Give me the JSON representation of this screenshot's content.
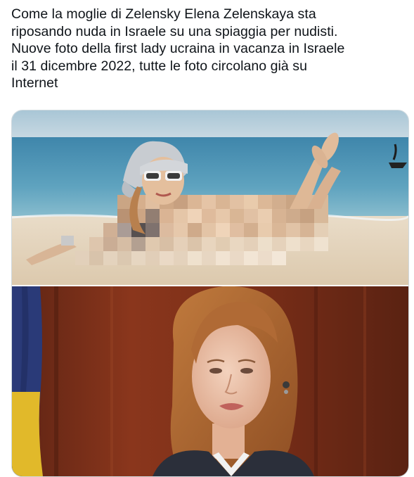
{
  "tweet": {
    "text": "Come la moglie di Zelensky Elena Zelenskaya sta\nriposando nuda in Israele su una spiaggia per nudisti.\nNuove foto della first lady ucraina in vacanza in Israele\nil 31 dicembre 2022, tutte le foto circolano già su\nInternet"
  },
  "media": {
    "images": [
      {
        "name": "beach-photo"
      },
      {
        "name": "portrait-photo"
      }
    ]
  },
  "colors": {
    "text": "#0f1419",
    "border": "#cfd9de",
    "sea": "#4a8fb0",
    "sand": "#e7d9c4",
    "wood": "#7a2e1b",
    "hair": "#b8733f"
  }
}
